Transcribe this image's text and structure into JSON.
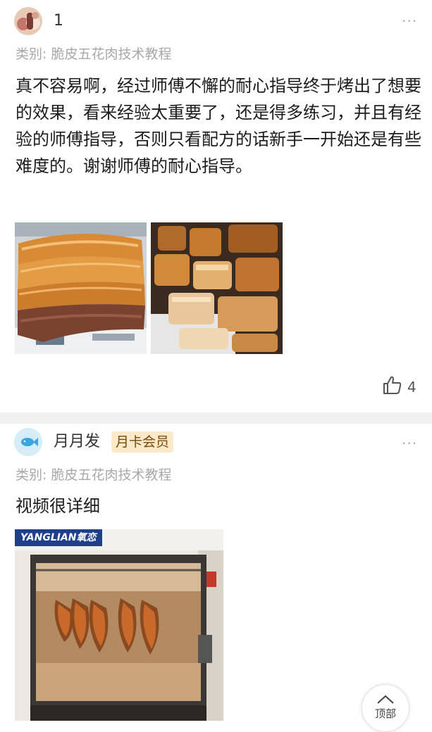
{
  "posts": [
    {
      "username": "1",
      "category": "类别: 脆皮五花肉技术教程",
      "content": "真不容易啊，经过师傅不懈的耐心指导终于烤出了想要的效果，看来经验太重要了，还是得多练习，并且有经验的师傅指导，否则只看配方的话新手一开始还是有些难度的。谢谢师傅的耐心指导。",
      "images": [
        "crispy-pork-belly-slab",
        "chopped-crispy-pork"
      ],
      "likes": "4"
    },
    {
      "username": "月月发",
      "badge": "月卡会员",
      "category": "类别: 脆皮五花肉技术教程",
      "content": "视频很详细",
      "image_brand": "YANGLIAN氧恋"
    }
  ],
  "top_button": "顶部",
  "more_icon": "···",
  "colors": {
    "badge_bg": "#fbe9c9",
    "badge_text": "#7a4a08",
    "separator": "#f0f0f0",
    "category": "#a8a8a8"
  }
}
